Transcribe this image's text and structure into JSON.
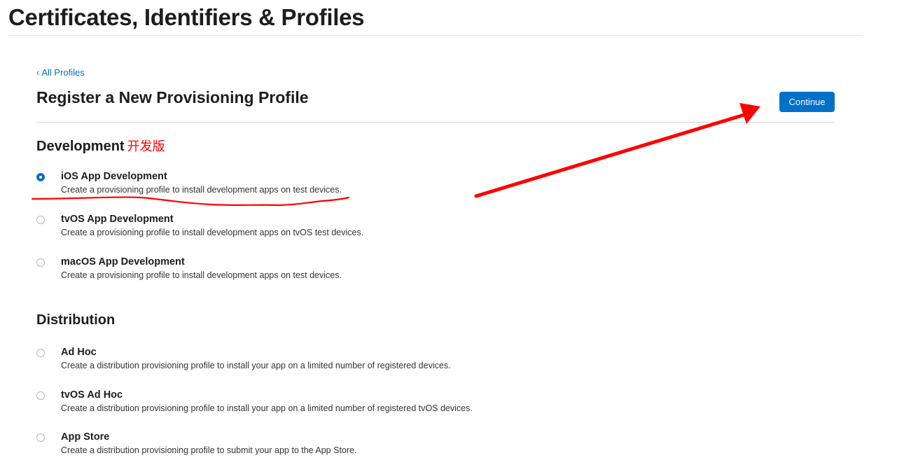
{
  "header": {
    "app_title": "Certificates, Identifiers & Profiles"
  },
  "nav": {
    "back_chevron": "‹",
    "back_label": "All Profiles"
  },
  "page": {
    "title": "Register a New Provisioning Profile",
    "continue_label": "Continue"
  },
  "development": {
    "title": "Development",
    "note": "开发版",
    "options": [
      {
        "title": "iOS App Development",
        "description": "Create a provisioning profile to install development apps on test devices.",
        "selected": true
      },
      {
        "title": "tvOS App Development",
        "description": "Create a provisioning profile to install development apps on tvOS test devices.",
        "selected": false
      },
      {
        "title": "macOS App Development",
        "description": "Create a provisioning profile to install development apps on test devices.",
        "selected": false
      }
    ]
  },
  "distribution": {
    "title": "Distribution",
    "options": [
      {
        "title": "Ad Hoc",
        "description": "Create a distribution provisioning profile to install your app on a limited number of registered devices.",
        "selected": false
      },
      {
        "title": "tvOS Ad Hoc",
        "description": "Create a distribution provisioning profile to install your app on a limited number of registered tvOS devices.",
        "selected": false
      },
      {
        "title": "App Store",
        "description": "Create a distribution provisioning profile to submit your app to the App Store.",
        "selected": false
      }
    ]
  },
  "colors": {
    "accent": "#0070c9",
    "annotation": "#ff0000"
  }
}
